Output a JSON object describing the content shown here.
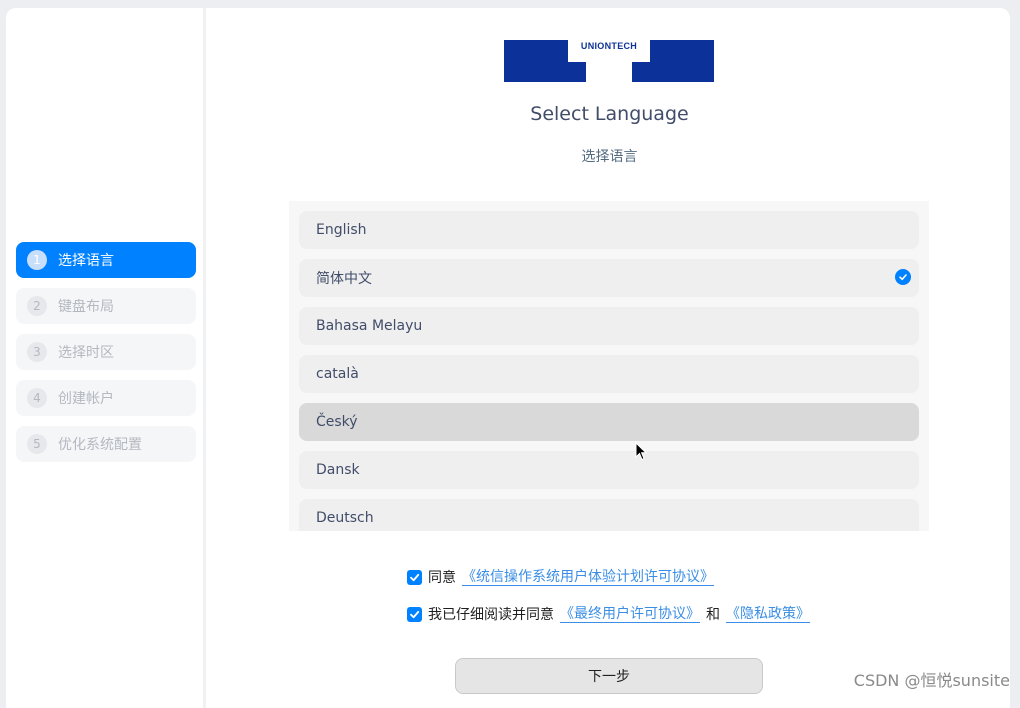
{
  "sidebar": {
    "steps": [
      {
        "num": "1",
        "label": "选择语言",
        "active": true
      },
      {
        "num": "2",
        "label": "键盘布局",
        "active": false
      },
      {
        "num": "3",
        "label": "选择时区",
        "active": false
      },
      {
        "num": "4",
        "label": "创建帐户",
        "active": false
      },
      {
        "num": "5",
        "label": "优化系统配置",
        "active": false
      }
    ]
  },
  "logo": {
    "text": "UNIONTECH",
    "color": "#0c3199"
  },
  "header": {
    "title": "Select Language",
    "subtitle": "选择语言"
  },
  "languages": [
    {
      "label": "English",
      "selected": false
    },
    {
      "label": "简体中文",
      "selected": true
    },
    {
      "label": "Bahasa Melayu",
      "selected": false
    },
    {
      "label": "català",
      "selected": false
    },
    {
      "label": "Český",
      "selected": false,
      "hovered": true
    },
    {
      "label": "Dansk",
      "selected": false
    },
    {
      "label": "Deutsch",
      "selected": false
    }
  ],
  "agreements": {
    "first": {
      "checked": true,
      "prefix": "同意",
      "link": "《统信操作系统用户体验计划许可协议》"
    },
    "second": {
      "checked": true,
      "prefix": "我已仔细阅读并同意",
      "link1": "《最终用户许可协议》",
      "and": "和",
      "link2": "《隐私政策》"
    }
  },
  "next_button": "下一步",
  "watermark": "CSDN @恒悦sunsite",
  "colors": {
    "accent": "#0081ff",
    "link": "#3a8ee6",
    "brand": "#0c3199"
  }
}
